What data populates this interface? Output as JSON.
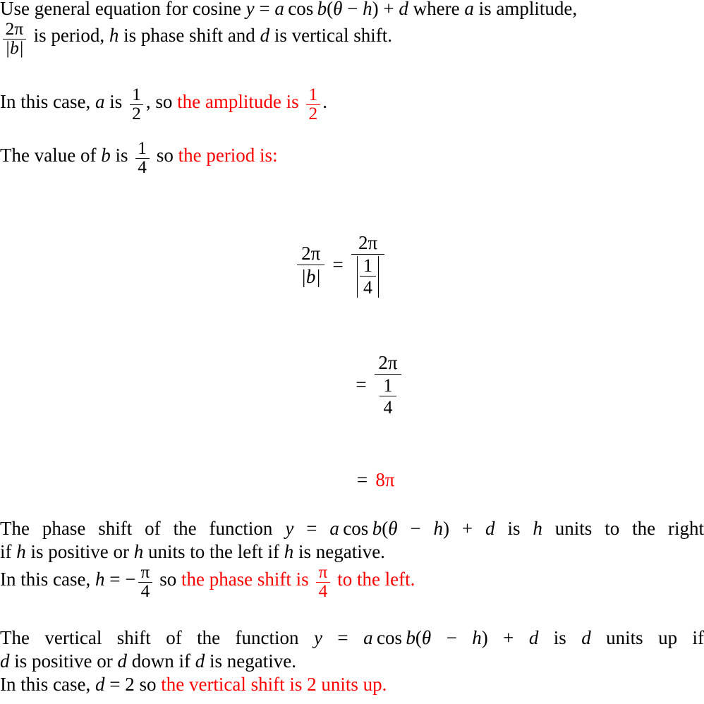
{
  "document": {
    "type": "math-worked-solution",
    "topic": "Cosine function transformations",
    "text_color": "#000000",
    "highlight_color": "#ff0000",
    "background_color": "#ffffff"
  },
  "intro": {
    "lead": "Use general equation for cosine",
    "general_equation": "y = a cos b(θ − h) + d",
    "where": "where",
    "a_var": "a",
    "is_amplitude": "is amplitude,",
    "period_frac_num": "2π",
    "period_frac_den": "|b|",
    "is_period": "is period,",
    "h_var": "h",
    "is_phase_shift": "is phase shift and",
    "d_var": "d",
    "is_vertical_shift": "is vertical shift."
  },
  "amplitude": {
    "prefix": "In this case,",
    "var": "a",
    "is": "is",
    "value_num": "1",
    "value_den": "2",
    "comma_so": ", so",
    "conclusion": "the amplitude is",
    "conclusion_num": "1",
    "conclusion_den": "2",
    "period_end": "."
  },
  "period_intro": {
    "prefix": "The value of",
    "var": "b",
    "is": "is",
    "value_num": "1",
    "value_den": "4",
    "so": "so",
    "conclusion": "the period is:"
  },
  "equations": [
    {
      "name": "period-formula",
      "lhs_num": "2π",
      "lhs_den": "|b|",
      "relation": "=",
      "rhs_num": "2π",
      "rhs_den_num": "1",
      "rhs_den_den": "4",
      "rhs_den_abs": true
    },
    {
      "name": "period-simplified",
      "relation": "=",
      "rhs_num": "2π",
      "rhs_den_num": "1",
      "rhs_den_den": "4",
      "rhs_den_abs": false
    },
    {
      "name": "period-result",
      "relation": "=",
      "result": "8π",
      "result_color": "#ff0000"
    }
  ],
  "phase_shift": {
    "line1_a": "The phase shift of the function",
    "equation": "y = a cos b(θ − h) + d",
    "line1_b": "is",
    "h_var": "h",
    "line1_c": "units to the right",
    "line2": "if h is positive or h units to the left if h is negative.",
    "line3_prefix": "In this case,",
    "line3_var": "h",
    "line3_eq": "= −",
    "value_num": "π",
    "value_den": "4",
    "so": "so",
    "conclusion_pre": "the phase shift is",
    "conclusion_num": "π",
    "conclusion_den": "4",
    "conclusion_post": "to the left."
  },
  "vertical_shift": {
    "line1_a": "The vertical shift of the function",
    "equation": "y = a cos b(θ − h) + d",
    "line1_b": "is",
    "d_var": "d",
    "line1_c": "units up if",
    "line2": "d is positive or d down if d is negative.",
    "line3_prefix": "In this case,",
    "line3_var": "d",
    "line3_eq": "= 2",
    "so": "so",
    "conclusion": "the vertical shift is 2 units up."
  },
  "math_symbols": {
    "theta": "θ",
    "pi": "π",
    "minus": "−",
    "plus": "+",
    "equals": "="
  }
}
